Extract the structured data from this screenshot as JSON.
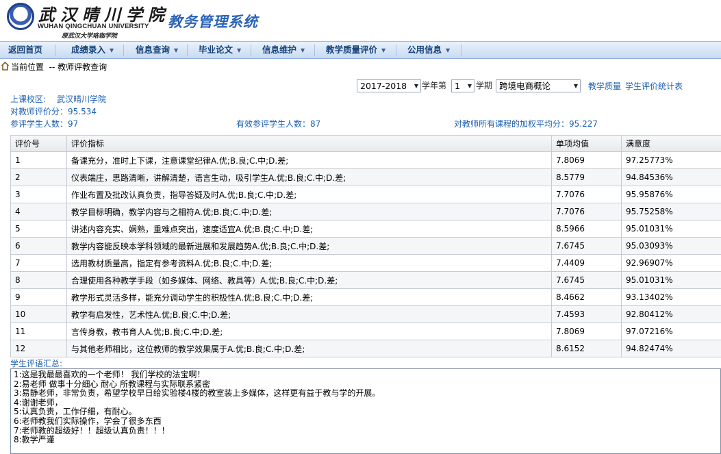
{
  "header": {
    "logo_cn": "武汉晴川学院",
    "logo_en": "WUHAN QINGCHUAN UNIVERSITY",
    "logo_sub": "原武汉大学珞珈学院",
    "system_title": "教务管理系统"
  },
  "nav": {
    "items": [
      {
        "label": "返回首页",
        "dropdown": false
      },
      {
        "label": "成绩录入",
        "dropdown": true
      },
      {
        "label": "信息查询",
        "dropdown": true
      },
      {
        "label": "毕业论文",
        "dropdown": true
      },
      {
        "label": "信息维护",
        "dropdown": true
      },
      {
        "label": "教学质量评价",
        "dropdown": true
      },
      {
        "label": "公用信息",
        "dropdown": true
      }
    ]
  },
  "breadcrumb": {
    "text": "当前位置  -- 教师评教查询"
  },
  "filters": {
    "year": "2017-2018",
    "year_suffix": "学年第",
    "term": "1",
    "term_suffix": "学期",
    "course": "跨境电商概论",
    "link1": "教学质量",
    "link2": "学生评价统计表"
  },
  "info": {
    "campus_label": "上课校区:",
    "campus_value": "武汉晴川学院",
    "score_text": "对教师评价分：95.534",
    "participants_text": "参评学生人数：97",
    "valid_text": "有效参评学生人数：87",
    "weighted_text": "对教师所有课程的加权平均分：95.227"
  },
  "table": {
    "headers": [
      "评价号",
      "评价指标",
      "单项均值",
      "满意度"
    ],
    "rows": [
      [
        "1",
        "备课充分，准时上下课，注意课堂纪律A.优;B.良;C.中;D.差;",
        "7.8069",
        "97.25773%"
      ],
      [
        "2",
        "仪表端庄，思路清晰，讲解清楚，语言生动，吸引学生A.优;B.良;C.中;D.差;",
        "8.5779",
        "94.84536%"
      ],
      [
        "3",
        "作业布置及批改认真负责，指导答疑及时A.优;B.良;C.中;D.差;",
        "7.7076",
        "95.95876%"
      ],
      [
        "4",
        "教学目标明确，教学内容与之相符A.优;B.良;C.中;D.差;",
        "7.7076",
        "95.75258%"
      ],
      [
        "5",
        "讲述内容充实、娴熟，重难点突出，速度适宜A.优;B.良;C.中;D.差;",
        "8.5966",
        "95.01031%"
      ],
      [
        "6",
        "教学内容能反映本学科领域的最新进展和发展趋势A.优;B.良;C.中;D.差;",
        "7.6745",
        "95.03093%"
      ],
      [
        "7",
        "选用教材质量高，指定有参考资料A.优;B.良;C.中;D.差;",
        "7.4409",
        "92.96907%"
      ],
      [
        "8",
        "合理使用各种教学手段（如多媒体、网络、教具等）A.优;B.良;C.中;D.差;",
        "7.6745",
        "95.01031%"
      ],
      [
        "9",
        "教学形式灵活多样，能充分调动学生的积极性A.优;B.良;C.中;D.差;",
        "8.4662",
        "93.13402%"
      ],
      [
        "10",
        "教学有启发性，艺术性A.优;B.良;C.中;D.差;",
        "7.4593",
        "92.80412%"
      ],
      [
        "11",
        "言传身教，教书育人A.优;B.良;C.中;D.差;",
        "7.8069",
        "97.07216%"
      ],
      [
        "12",
        "与其他老师相比，这位教师的教学效果属于A.优;B.良;C.中;D.差;",
        "8.6152",
        "94.82474%"
      ]
    ]
  },
  "comments": {
    "label": "学生评语汇总:",
    "lines": [
      "1:这是我最最喜欢的一个老师！ 我们学校的法宝啊！",
      "2:易老师 做事十分细心 耐心 所教课程与实际联系紧密",
      "3:易静老师，非常负责，希望学校早日给实验楼4楼的教室装上多媒体，这样更有益于教与学的开展。",
      "4:谢谢老师，",
      "5:认真负责，工作仔细，有耐心。",
      "6:老师教我们实际操作，学会了很多东西",
      "7:老师教的超级好！！超级认真负责！！！",
      "8:教学严谨"
    ]
  }
}
